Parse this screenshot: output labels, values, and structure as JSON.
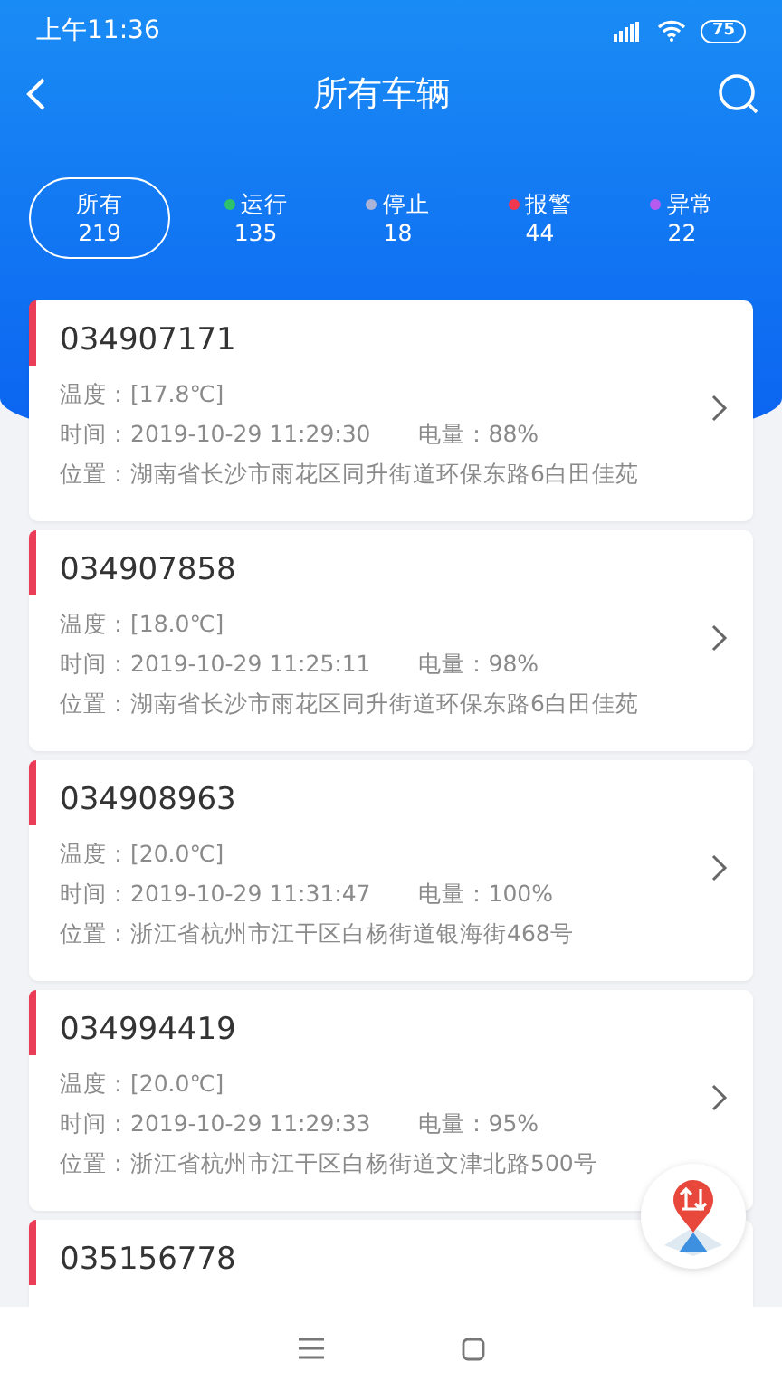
{
  "status_bar": {
    "time": "上午11:36",
    "battery": "75"
  },
  "header": {
    "title": "所有车辆"
  },
  "filters": [
    {
      "label": "所有",
      "count": "219",
      "selected": true
    },
    {
      "label": "运行",
      "count": "135",
      "selected": false,
      "color": "#2ec36b"
    },
    {
      "label": "停止",
      "count": "18",
      "selected": false,
      "color": "#a9b3d8"
    },
    {
      "label": "报警",
      "count": "44",
      "selected": false,
      "color": "#f0384f"
    },
    {
      "label": "异常",
      "count": "22",
      "selected": false,
      "color": "#b45cf0"
    }
  ],
  "vehicles": [
    {
      "id": "034907171",
      "temperature": "温度：[17.8℃]",
      "time": "时间：2019-10-29 11:29:30",
      "battery": "电量：88%",
      "location": "位置：湖南省长沙市雨花区同升街道环保东路6白田佳苑"
    },
    {
      "id": "034907858",
      "temperature": "温度：[18.0℃]",
      "time": "时间：2019-10-29 11:25:11",
      "battery": "电量：98%",
      "location": "位置：湖南省长沙市雨花区同升街道环保东路6白田佳苑"
    },
    {
      "id": "034908963",
      "temperature": "温度：[20.0℃]",
      "time": "时间：2019-10-29 11:31:47",
      "battery": "电量：100%",
      "location": "位置：浙江省杭州市江干区白杨街道银海街468号"
    },
    {
      "id": "034994419",
      "temperature": "温度：[20.0℃]",
      "time": "时间：2019-10-29 11:29:33",
      "battery": "电量：95%",
      "location": "位置：浙江省杭州市江干区白杨街道文津北路500号"
    },
    {
      "id": "035156778"
    }
  ]
}
